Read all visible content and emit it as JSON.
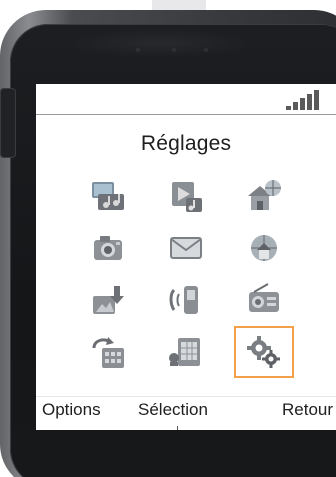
{
  "screen": {
    "title": "Réglages",
    "signal_bars": 5
  },
  "menu": {
    "items": [
      {
        "icon": "gallery-music-icon",
        "selected": false
      },
      {
        "icon": "video-music-icon",
        "selected": false
      },
      {
        "icon": "home-network-icon",
        "selected": false
      },
      {
        "icon": "camera-icon",
        "selected": false
      },
      {
        "icon": "envelope-icon",
        "selected": false
      },
      {
        "icon": "home-globe-icon",
        "selected": false
      },
      {
        "icon": "download-image-icon",
        "selected": false
      },
      {
        "icon": "call-transfer-icon",
        "selected": false
      },
      {
        "icon": "radio-icon",
        "selected": false
      },
      {
        "icon": "sync-calendar-icon",
        "selected": false
      },
      {
        "icon": "organizer-icon",
        "selected": false
      },
      {
        "icon": "settings-gear-icon",
        "selected": true
      }
    ]
  },
  "softkeys": {
    "left": "Options",
    "center": "Sélection",
    "right": "Retour"
  },
  "colors": {
    "selection_border": "#f2a14a",
    "screen_background": "#ffffff",
    "text": "#202020"
  }
}
